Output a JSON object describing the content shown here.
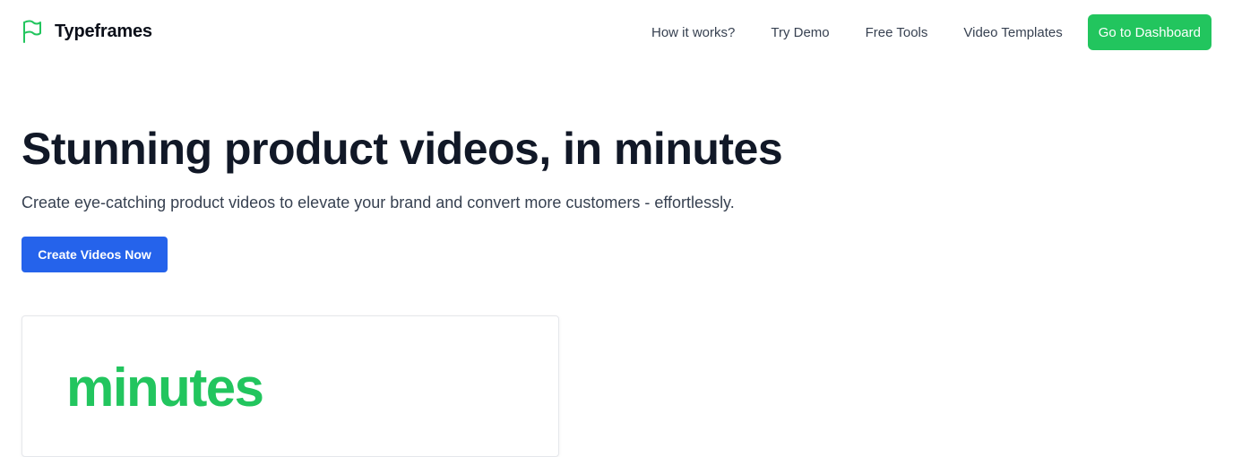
{
  "brand": {
    "name": "Typeframes",
    "icon": "flag-icon",
    "accent_color": "#22c55e"
  },
  "nav": {
    "links": [
      {
        "label": "How it works?"
      },
      {
        "label": "Try Demo"
      },
      {
        "label": "Free Tools"
      },
      {
        "label": "Video Templates"
      }
    ],
    "dashboard_label": "Go to Dashboard",
    "dashboard_color": "#22c55e"
  },
  "hero": {
    "title": "Stunning product videos, in minutes",
    "subtitle": "Create eye-catching product videos to elevate your brand and convert more customers - effortlessly.",
    "cta_label": "Create Videos Now",
    "cta_color": "#2563eb"
  },
  "preview": {
    "word": "minutes",
    "word_color": "#22c55e"
  }
}
